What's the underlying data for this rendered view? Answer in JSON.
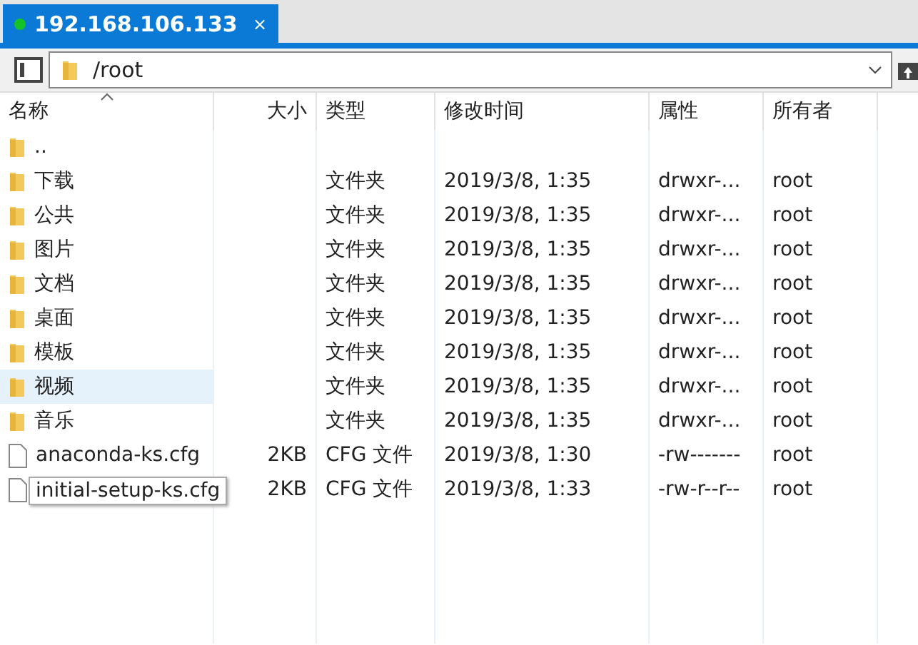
{
  "tab": {
    "title": "192.168.106.133",
    "connected": true,
    "close": "×"
  },
  "path": {
    "value": "/root"
  },
  "columns": [
    {
      "label": "名称",
      "sorted": true
    },
    {
      "label": "大小",
      "sorted": false
    },
    {
      "label": "类型",
      "sorted": false
    },
    {
      "label": "修改时间",
      "sorted": false
    },
    {
      "label": "属性",
      "sorted": false
    },
    {
      "label": "所有者",
      "sorted": false
    }
  ],
  "rows": [
    {
      "kind": "folder",
      "name": "..",
      "selected": false
    },
    {
      "kind": "folder",
      "name": "下载",
      "type": "文件夹",
      "modified": "2019/3/8, 1:35",
      "attrs": "drwxr-...",
      "owner": "root",
      "selected": false
    },
    {
      "kind": "folder",
      "name": "公共",
      "type": "文件夹",
      "modified": "2019/3/8, 1:35",
      "attrs": "drwxr-...",
      "owner": "root",
      "selected": false
    },
    {
      "kind": "folder",
      "name": "图片",
      "type": "文件夹",
      "modified": "2019/3/8, 1:35",
      "attrs": "drwxr-...",
      "owner": "root",
      "selected": false
    },
    {
      "kind": "folder",
      "name": "文档",
      "type": "文件夹",
      "modified": "2019/3/8, 1:35",
      "attrs": "drwxr-...",
      "owner": "root",
      "selected": false
    },
    {
      "kind": "folder",
      "name": "桌面",
      "type": "文件夹",
      "modified": "2019/3/8, 1:35",
      "attrs": "drwxr-...",
      "owner": "root",
      "selected": false
    },
    {
      "kind": "folder",
      "name": "模板",
      "type": "文件夹",
      "modified": "2019/3/8, 1:35",
      "attrs": "drwxr-...",
      "owner": "root",
      "selected": false
    },
    {
      "kind": "folder",
      "name": "视频",
      "type": "文件夹",
      "modified": "2019/3/8, 1:35",
      "attrs": "drwxr-...",
      "owner": "root",
      "selected": true
    },
    {
      "kind": "folder",
      "name": "音乐",
      "type": "文件夹",
      "modified": "2019/3/8, 1:35",
      "attrs": "drwxr-...",
      "owner": "root",
      "selected": false
    },
    {
      "kind": "file",
      "name": "anaconda-ks.cfg",
      "size": "2KB",
      "type": "CFG 文件",
      "modified": "2019/3/8, 1:30",
      "attrs": "-rw-------",
      "owner": "root",
      "selected": false
    },
    {
      "kind": "file",
      "tooltip": "initial-setup-ks.cfg",
      "size": "2KB",
      "type": "CFG 文件",
      "modified": "2019/3/8, 1:33",
      "attrs": "-rw-r--r--",
      "owner": "root",
      "selected": false
    }
  ]
}
